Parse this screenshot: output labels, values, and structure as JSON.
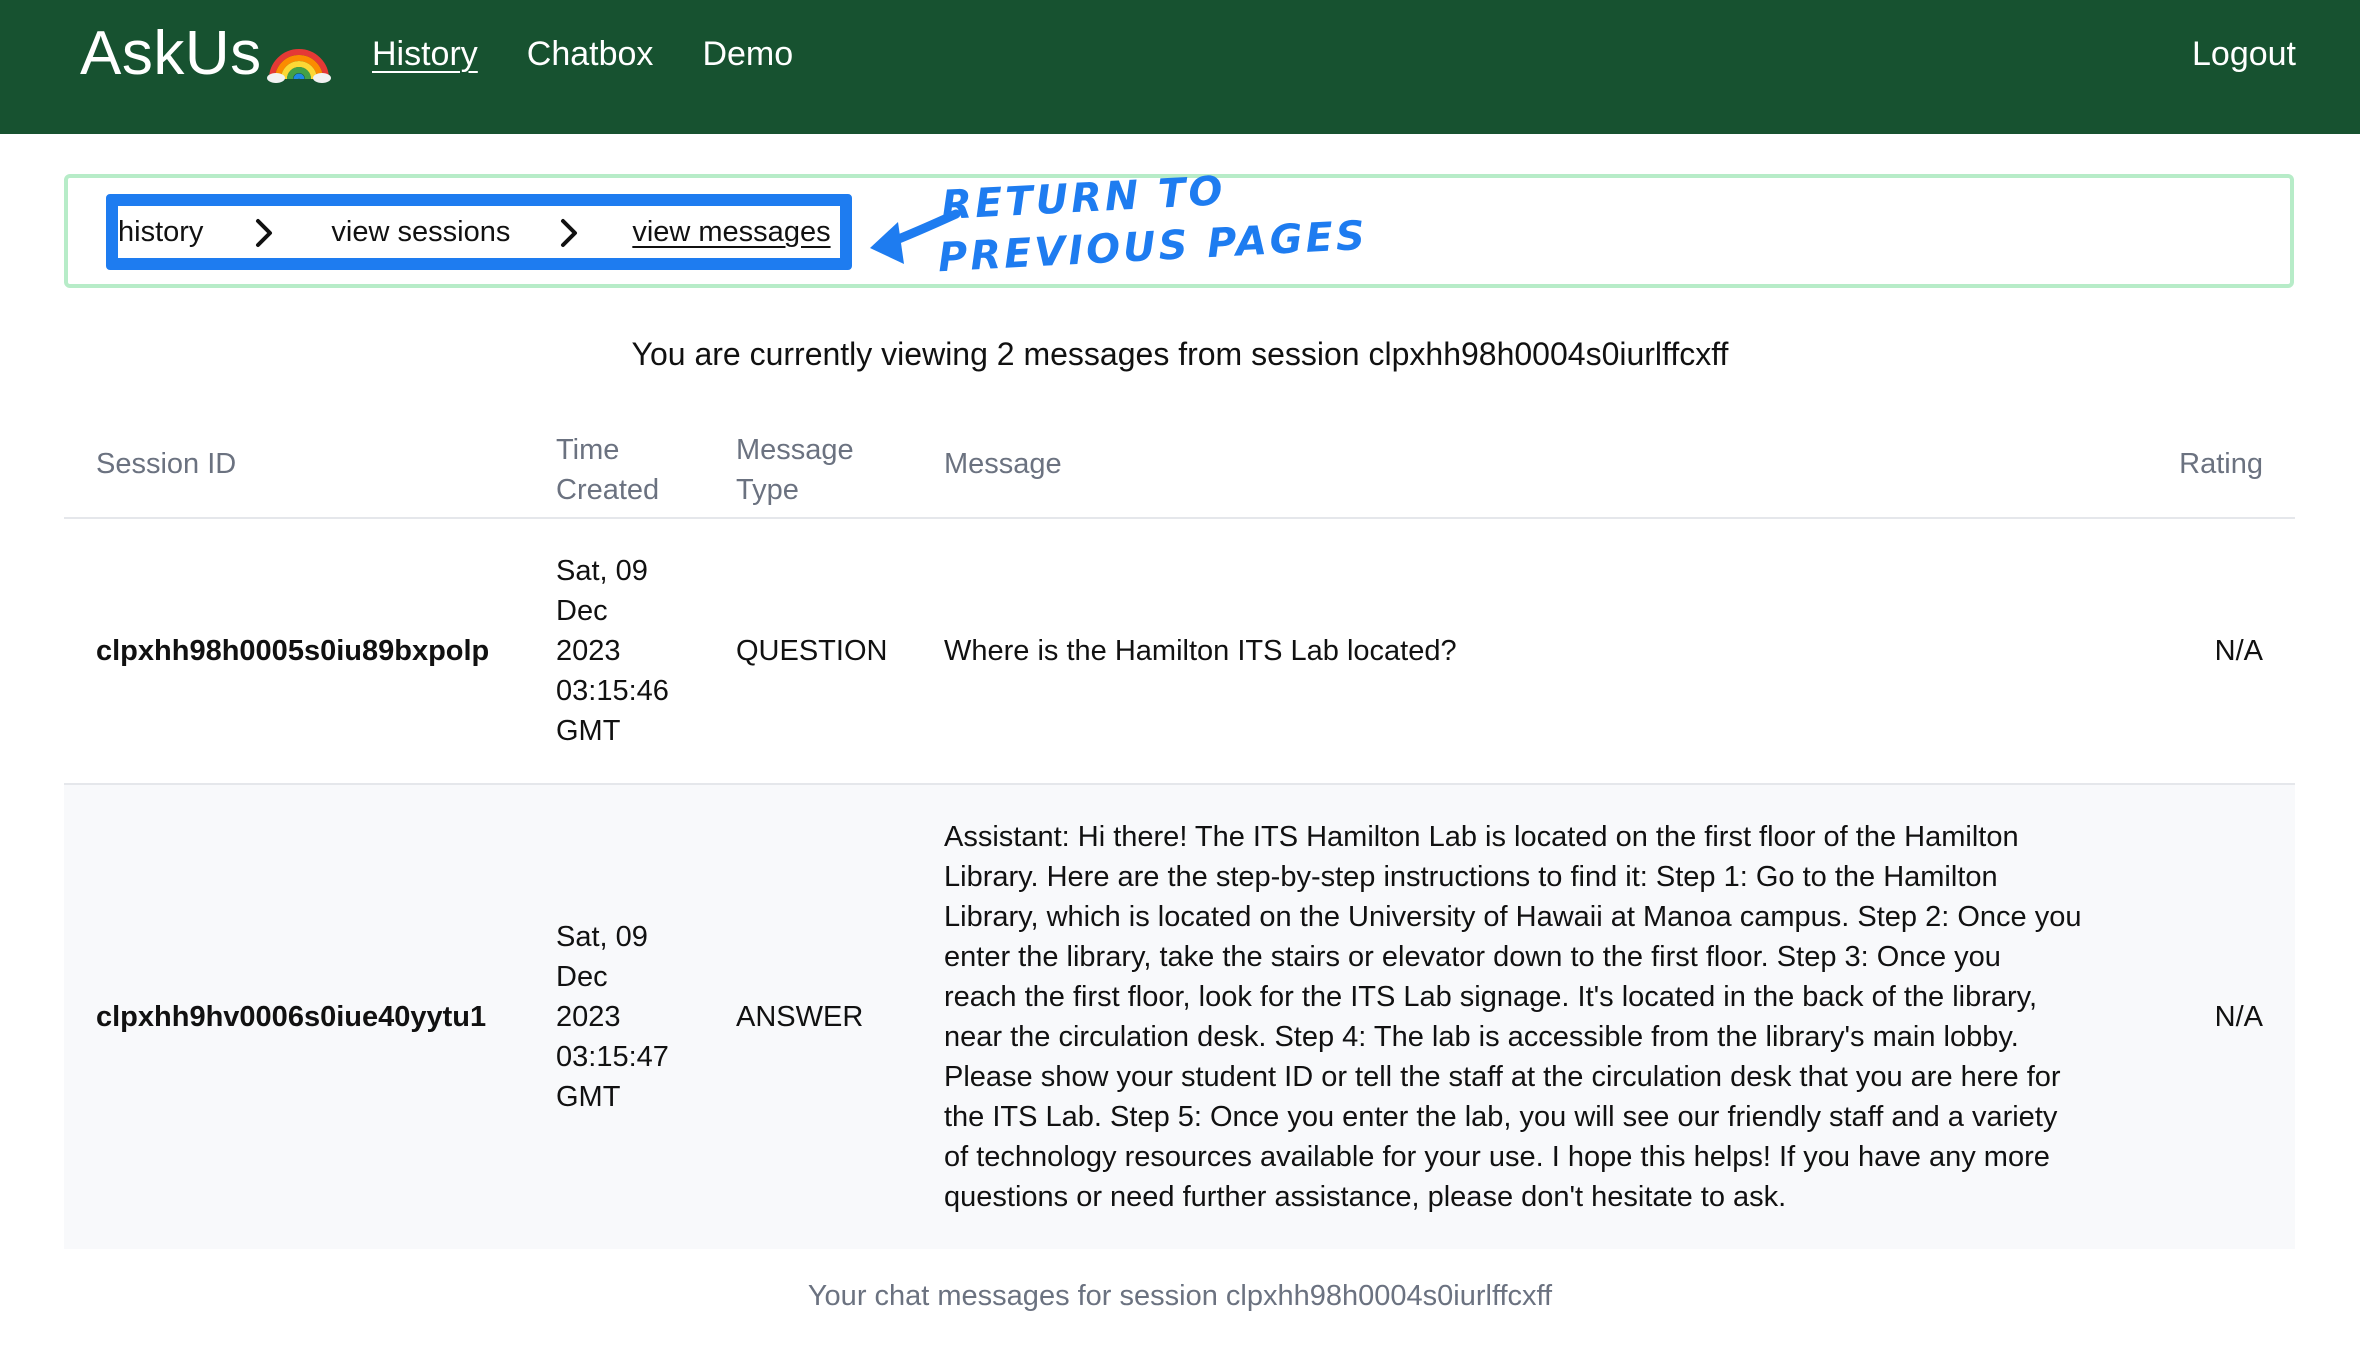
{
  "navbar": {
    "brand": "AskUs",
    "brand_icon": "rainbow-icon",
    "links": [
      "History",
      "Chatbox",
      "Demo"
    ],
    "active_link": "History",
    "logout": "Logout",
    "background": "#175230"
  },
  "breadcrumb": {
    "items": [
      "history",
      "view sessions",
      "view messages"
    ],
    "separator_icon": "chevron-right-icon",
    "highlight_color": "#1e7cf0",
    "annotation_line1": "RETURN TO",
    "annotation_line2": "PREVIOUS PAGES"
  },
  "summary": "You are currently viewing 2 messages from session clpxhh98h0004s0iurlffcxff",
  "table": {
    "headers": {
      "session_id": "Session ID",
      "time_created_1": "Time",
      "time_created_2": "Created",
      "message_type_1": "Message",
      "message_type_2": "Type",
      "message": "Message",
      "rating": "Rating"
    },
    "rows": [
      {
        "session_id": "clpxhh98h0005s0iu89bxpolp",
        "time": [
          "Sat, 09",
          "Dec",
          "2023",
          "03:15:46",
          "GMT"
        ],
        "type": "QUESTION",
        "message": "Where is the Hamilton ITS Lab located?",
        "rating": "N/A"
      },
      {
        "session_id": "clpxhh9hv0006s0iue40yytu1",
        "time": [
          "Sat, 09",
          "Dec",
          "2023",
          "03:15:47",
          "GMT"
        ],
        "type": "ANSWER",
        "message_lines": [
          "Assistant: Hi there! The ITS Hamilton Lab is located on the first floor of the Hamilton",
          "Library. Here are the step-by-step instructions to find it: Step 1: Go to the Hamilton",
          "Library, which is located on the University of Hawaii at Manoa campus. Step 2: Once you",
          "enter the library, take the stairs or elevator down to the first floor. Step 3: Once you",
          "reach the first floor, look for the ITS Lab signage. It's located in the back of the library,",
          "near the circulation desk. Step 4: The lab is accessible from the library's main lobby.",
          "Please show your student ID or tell the staff at the circulation desk that you are here for",
          "the ITS Lab. Step 5: Once you enter the lab, you will see our friendly staff and a variety",
          "of technology resources available for your use. I hope this helps! If you have any more",
          "questions or need further assistance, please don't hesitate to ask."
        ],
        "rating": "N/A"
      }
    ]
  },
  "caption": "Your chat messages for session clpxhh98h0004s0iurlffcxff"
}
